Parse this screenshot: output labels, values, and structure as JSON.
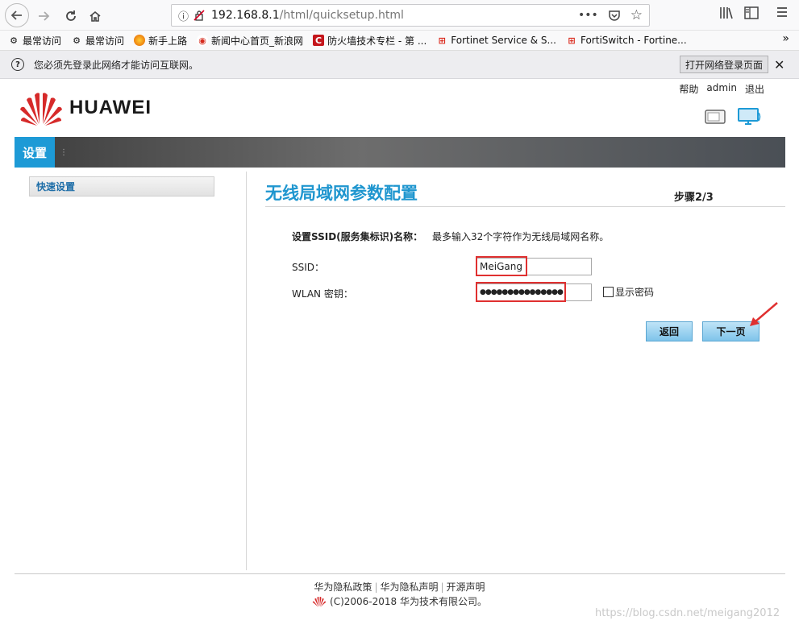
{
  "browser": {
    "url_host": "192.168.8.1",
    "url_path": "/html/quicksetup.html",
    "bookmarks": [
      {
        "label": "最常访问",
        "icon": "gear-icon"
      },
      {
        "label": "最常访问",
        "icon": "gear-icon"
      },
      {
        "label": "新手上路",
        "icon": "firefox-icon"
      },
      {
        "label": "新闻中心首页_新浪网",
        "icon": "sina-icon"
      },
      {
        "label": "防火墙技术专栏 - 第 ...",
        "icon": "csdn-icon"
      },
      {
        "label": "Fortinet Service & S...",
        "icon": "fortinet-icon"
      },
      {
        "label": "FortiSwitch - Fortine...",
        "icon": "fortinet-icon"
      }
    ],
    "notification_text": "您必须先登录此网络才能访问互联网。",
    "notification_button": "打开网络登录页面"
  },
  "header": {
    "logo_text": "HUAWEI",
    "links": {
      "help": "帮助",
      "user": "admin",
      "logout": "退出"
    }
  },
  "nav": {
    "tab_label": "设置"
  },
  "sidebar": {
    "items": [
      {
        "label": "快速设置"
      }
    ]
  },
  "main": {
    "title": "无线局域网参数配置",
    "step": "步骤2/3",
    "desc_label": "设置SSID(服务集标识)名称：",
    "desc_hint": "最多输入32个字符作为无线局域网名称。",
    "ssid_label": "SSID：",
    "ssid_value": "MeiGang",
    "key_label": "WLAN 密钥：",
    "key_value": "●●●●●●●●●●●●●●●",
    "show_password": "显示密码",
    "back_button": "返回",
    "next_button": "下一页"
  },
  "footer": {
    "links": [
      "华为隐私政策",
      "华为隐私声明",
      "开源声明"
    ],
    "copyright": "(C)2006-2018 华为技术有限公司。"
  },
  "watermark": "https://blog.csdn.net/meigang2012",
  "colors": {
    "accent": "#1d9ad6",
    "title": "#1f96cf",
    "highlight": "#e03030",
    "huawei_red": "#d62a2a"
  }
}
